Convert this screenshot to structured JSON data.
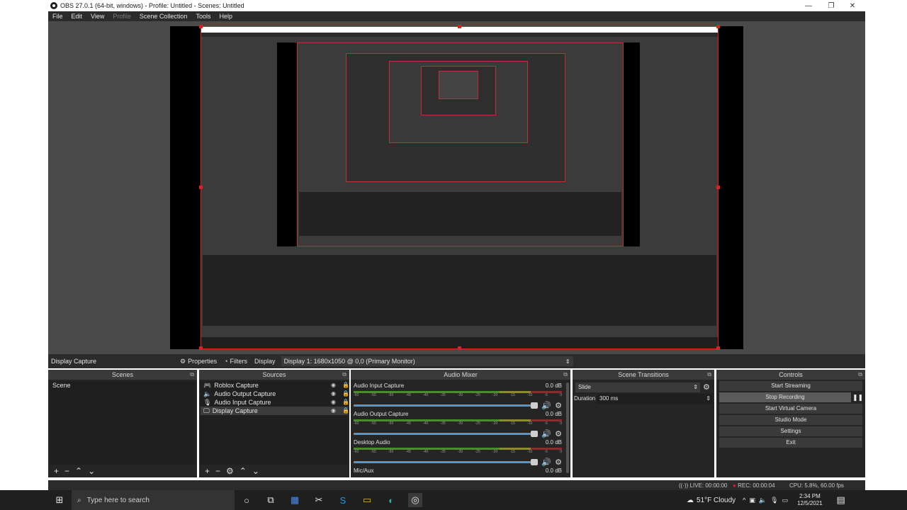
{
  "window": {
    "title": "OBS 27.0.1 (64-bit, windows) - Profile: Untitled - Scenes: Untitled",
    "minimize": "—",
    "maximize": "❐",
    "close": "✕"
  },
  "menu": [
    "File",
    "Edit",
    "View",
    "Profile",
    "Scene Collection",
    "Tools",
    "Help"
  ],
  "menu_disabled": "Profile",
  "properties_bar": {
    "source_name": "Display Capture",
    "properties_label": "Properties",
    "filters_label": "Filters",
    "display_label": "Display",
    "display_value": "Display 1: 1680x1050 @ 0,0 (Primary Monitor)"
  },
  "scenes": {
    "title": "Scenes",
    "items": [
      "Scene"
    ]
  },
  "sources": {
    "title": "Sources",
    "items": [
      {
        "name": "Roblox Capture",
        "icon": "gamepad-icon"
      },
      {
        "name": "Audio Output Capture",
        "icon": "speaker-icon"
      },
      {
        "name": "Audio Input Capture",
        "icon": "microphone-icon"
      },
      {
        "name": "Display Capture",
        "icon": "monitor-icon"
      }
    ]
  },
  "mixer": {
    "title": "Audio Mixer",
    "channels": [
      {
        "name": "Audio Input Capture",
        "db": "0.0 dB"
      },
      {
        "name": "Audio Output Capture",
        "db": "0.0 dB"
      },
      {
        "name": "Desktop Audio",
        "db": "0.0 dB"
      },
      {
        "name": "Mic/Aux",
        "db": "0.0 dB"
      }
    ],
    "ticks": [
      "-60",
      "-55",
      "-50",
      "-45",
      "-40",
      "-35",
      "-30",
      "-25",
      "-20",
      "-15",
      "-10",
      "-5",
      "0"
    ]
  },
  "transitions": {
    "title": "Scene Transitions",
    "selected": "Slide",
    "duration_label": "Duration",
    "duration_value": "300 ms"
  },
  "controls": {
    "title": "Controls",
    "buttons": [
      "Start Streaming",
      "Stop Recording",
      "Start Virtual Camera",
      "Studio Mode",
      "Settings",
      "Exit"
    ]
  },
  "status": {
    "live": "LIVE: 00:00:00",
    "rec": "REC: 00:00:04",
    "cpu": "CPU: 5.8%, 60.00 fps"
  },
  "taskbar": {
    "search_placeholder": "Type here to search",
    "weather": "51°F  Cloudy",
    "time": "2:34 PM",
    "date": "12/5/2021"
  },
  "colors": {
    "selection_border": "#e02020",
    "slider": "#4a9ad9",
    "rec_dot": "#e02020"
  }
}
